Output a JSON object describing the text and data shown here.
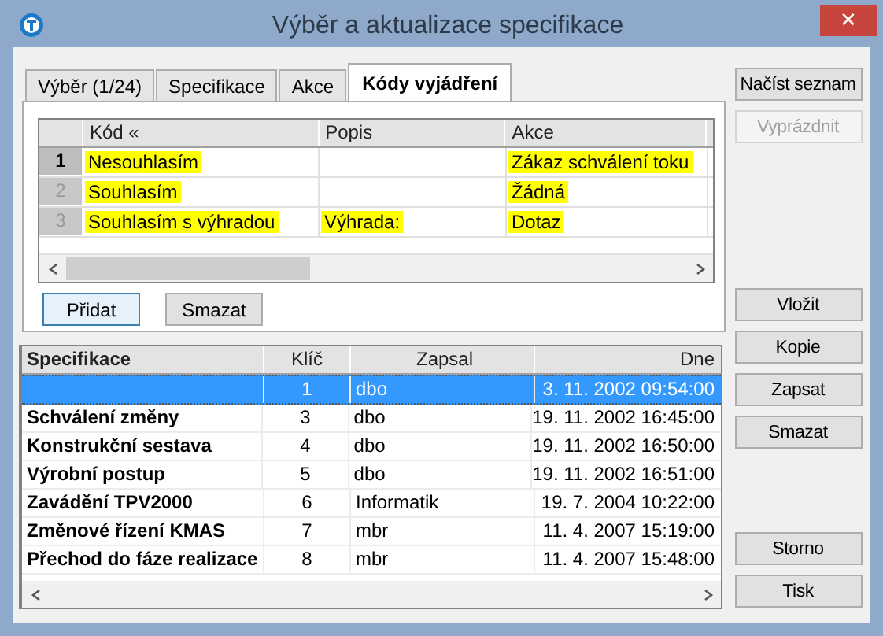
{
  "window": {
    "title": "Výběr a aktualizace specifikace",
    "close": "✕"
  },
  "tabs": [
    {
      "label": "Výběr (1/24)",
      "selected": false
    },
    {
      "label": "Specifikace",
      "selected": false
    },
    {
      "label": "Akce",
      "selected": false
    },
    {
      "label": "Kódy vyjádření",
      "selected": true
    }
  ],
  "codes_grid": {
    "columns": [
      "Kód «",
      "Popis",
      "Akce"
    ],
    "rows": [
      {
        "number": "1",
        "selected": true,
        "code": {
          "text": "Nesouhlasím",
          "highlighted": true
        },
        "action": {
          "text": "Zákaz schválení toku",
          "highlighted": true
        }
      },
      {
        "number": "2",
        "selected": false,
        "code": {
          "text": "Souhlasím",
          "highlighted": true
        },
        "action": {
          "text": "Žádná",
          "highlighted": true
        }
      },
      {
        "number": "3",
        "selected": false,
        "code": {
          "text": "Souhlasím s výhradou",
          "highlighted": true
        },
        "description": {
          "text": "Výhrada:",
          "highlighted": true
        },
        "action": {
          "text": "Dotaz",
          "highlighted": true
        }
      }
    ]
  },
  "codes_buttons": [
    {
      "label": "Přidat",
      "focused": true
    },
    {
      "label": "Smazat",
      "focused": false
    }
  ],
  "spec_table": {
    "columns": [
      "Specifikace",
      "Klíč",
      "Zapsal",
      "Dne"
    ],
    "rows": [
      {
        "selected": true,
        "key": "1",
        "author": "dbo",
        "date": "3. 11. 2002 09:54:00"
      },
      {
        "selected": false,
        "name": "Schválení změny",
        "key": "3",
        "author": "dbo",
        "date": "19. 11. 2002 16:45:00"
      },
      {
        "selected": false,
        "name": "Konstrukční sestava",
        "key": "4",
        "author": "dbo",
        "date": "19. 11. 2002 16:50:00"
      },
      {
        "selected": false,
        "name": "Výrobní postup",
        "key": "5",
        "author": "dbo",
        "date": "19. 11. 2002 16:51:00"
      },
      {
        "selected": false,
        "name": "Zavádění TPV2000",
        "key": "6",
        "author": "Informatik",
        "date": "19. 7. 2004 10:22:00"
      },
      {
        "selected": false,
        "name": "Změnové řízení KMAS",
        "key": "7",
        "author": "mbr",
        "date": "11. 4. 2007 15:19:00"
      },
      {
        "selected": false,
        "name": "Přechod do fáze realizace",
        "key": "8",
        "author": "mbr",
        "date": "11. 4. 2007 15:48:00"
      }
    ]
  },
  "side_buttons": {
    "top": [
      {
        "label": "Načíst seznam",
        "disabled": false
      },
      {
        "label": "Vyprázdnit",
        "disabled": true
      }
    ],
    "middle": [
      {
        "label": "Vložit",
        "disabled": false
      },
      {
        "label": "Kopie",
        "disabled": false
      },
      {
        "label": "Zapsat",
        "disabled": false
      },
      {
        "label": "Smazat",
        "disabled": false
      }
    ],
    "bottom": [
      {
        "label": "Storno",
        "disabled": false
      },
      {
        "label": "Tisk",
        "disabled": false
      }
    ]
  }
}
